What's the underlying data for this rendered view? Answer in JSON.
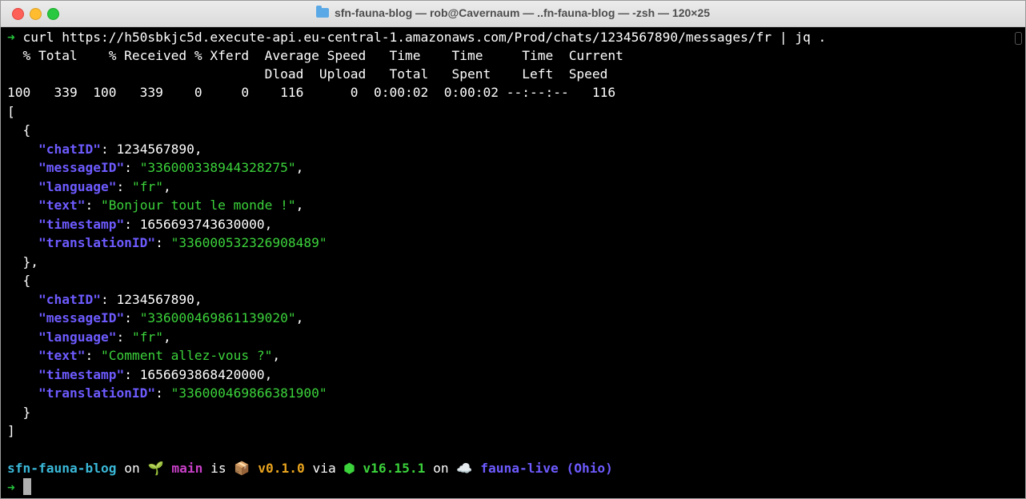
{
  "window": {
    "title": "sfn-fauna-blog — rob@Cavernaum — ..fn-fauna-blog — -zsh — 120×25",
    "folder_icon": "folder-icon"
  },
  "terminal": {
    "prompt_arrow": "➜",
    "command": "curl https://h50sbkjc5d.execute-api.eu-central-1.amazonaws.com/Prod/chats/1234567890/messages/fr | jq .",
    "curl_header_1": "  % Total    % Received % Xferd  Average Speed   Time    Time     Time  Current",
    "curl_header_2": "                                 Dload  Upload   Total   Spent    Left  Speed",
    "curl_progress": "100   339  100   339    0     0    116      0  0:00:02  0:00:02 --:--:--   116",
    "open_bracket": "[",
    "close_bracket": "]",
    "open_brace": "  {",
    "close_brace_comma": "  },",
    "close_brace": "  }",
    "messages": [
      {
        "chatID_key": "\"chatID\"",
        "chatID_val": "1234567890,",
        "messageID_key": "\"messageID\"",
        "messageID_val": "\"336000338944328275\"",
        "language_key": "\"language\"",
        "language_val": "\"fr\"",
        "text_key": "\"text\"",
        "text_val": "\"Bonjour tout le monde !\"",
        "timestamp_key": "\"timestamp\"",
        "timestamp_val": "1656693743630000,",
        "translationID_key": "\"translationID\"",
        "translationID_val": "\"336000532326908489\""
      },
      {
        "chatID_key": "\"chatID\"",
        "chatID_val": "1234567890,",
        "messageID_key": "\"messageID\"",
        "messageID_val": "\"336000469861139020\"",
        "language_key": "\"language\"",
        "language_val": "\"fr\"",
        "text_key": "\"text\"",
        "text_val": "\"Comment allez-vous ?\"",
        "timestamp_key": "\"timestamp\"",
        "timestamp_val": "1656693868420000,",
        "translationID_key": "\"translationID\"",
        "translationID_val": "\"336000469866381900\""
      }
    ],
    "status": {
      "dir": "sfn-fauna-blog",
      "on": "on",
      "branch_icon": "🌱",
      "branch": "main",
      "is": "is",
      "package_icon": "📦",
      "version": "v0.1.0",
      "via": "via",
      "node_icon": "⬢",
      "node_version": "v16.15.1",
      "on2": "on",
      "cloud_icon": "☁️",
      "aws_profile": "fauna-live (Ohio)"
    }
  },
  "colors": {
    "arrow": "#26c63d",
    "key": "#6d5bff",
    "string": "#3bd23b",
    "directory": "#3ab8d8",
    "branch": "#c840c8",
    "version": "#e8a31e"
  }
}
